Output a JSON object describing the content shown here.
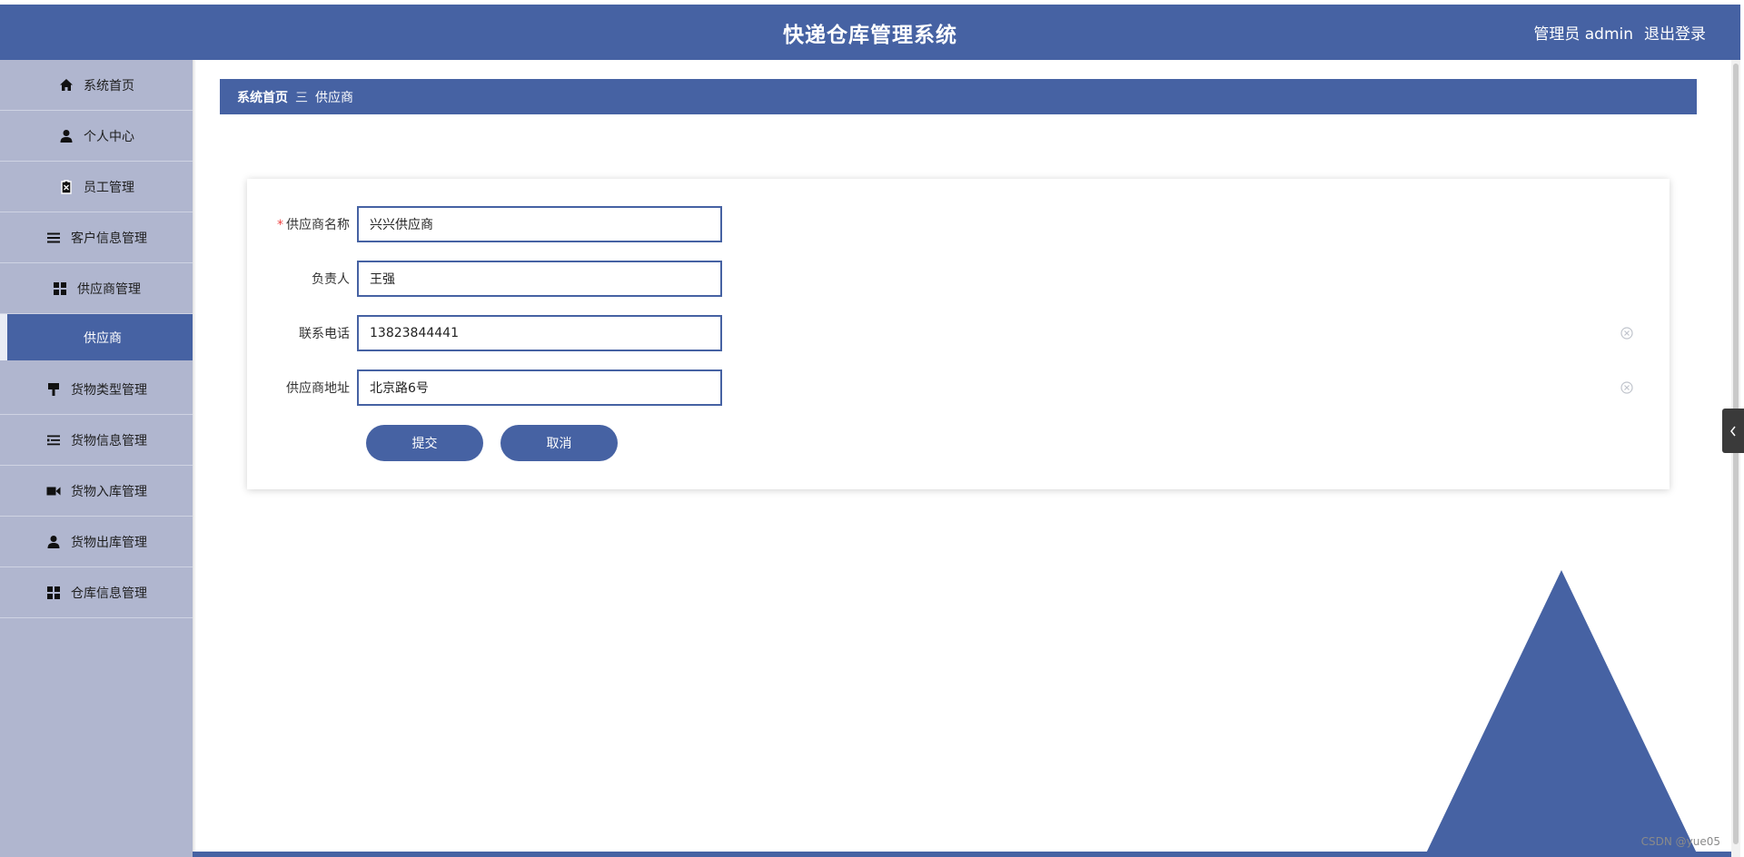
{
  "header": {
    "title": "快递仓库管理系统",
    "user_label": "管理员 admin",
    "logout_label": "退出登录"
  },
  "sidebar": {
    "items": [
      {
        "label": "系统首页",
        "icon": "home-icon"
      },
      {
        "label": "个人中心",
        "icon": "user-icon"
      },
      {
        "label": "员工管理",
        "icon": "clipboard-icon"
      },
      {
        "label": "客户信息管理",
        "icon": "list-icon"
      },
      {
        "label": "供应商管理",
        "icon": "grid-icon"
      },
      {
        "label": "供应商",
        "icon": ""
      },
      {
        "label": "货物类型管理",
        "icon": "brush-icon"
      },
      {
        "label": "货物信息管理",
        "icon": "list-indent-icon"
      },
      {
        "label": "货物入库管理",
        "icon": "video-icon"
      },
      {
        "label": "货物出库管理",
        "icon": "user-icon"
      },
      {
        "label": "仓库信息管理",
        "icon": "grid-icon"
      }
    ]
  },
  "breadcrumb": {
    "home": "系统首页",
    "separator": "三",
    "current": "供应商"
  },
  "form": {
    "fields": [
      {
        "label": "供应商名称",
        "value": "兴兴供应商",
        "required": true
      },
      {
        "label": "负责人",
        "value": "王强",
        "required": false
      },
      {
        "label": "联系电话",
        "value": "13823844441",
        "required": false
      },
      {
        "label": "供应商地址",
        "value": "北京路6号",
        "required": false
      }
    ],
    "submit_label": "提交",
    "cancel_label": "取消"
  },
  "watermark": "CSDN @yue05",
  "colors": {
    "primary": "#4662a3",
    "sidebar_bg": "#b0b6cf"
  }
}
